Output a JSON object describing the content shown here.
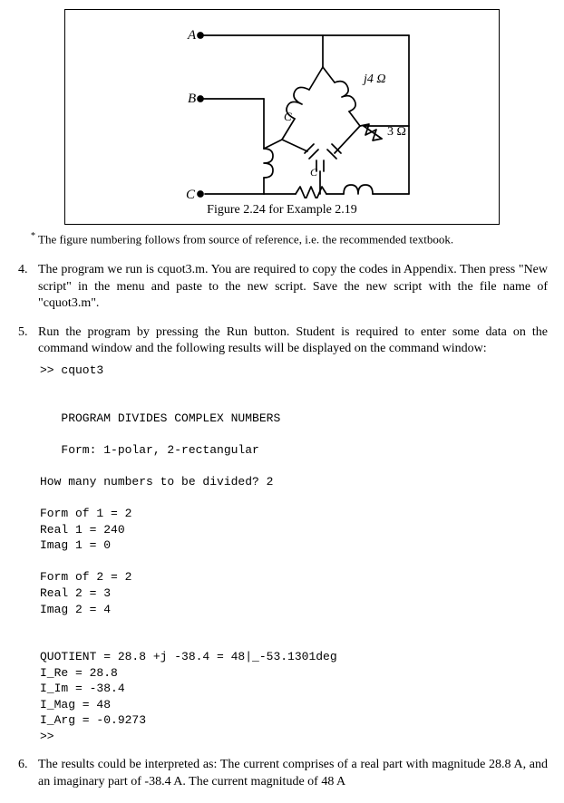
{
  "figure": {
    "labels": {
      "A": "A",
      "B": "B",
      "C_bottom": "C",
      "C_small1": "C",
      "C_small2": "C",
      "j4": "j4 Ω",
      "r3": "3 Ω"
    },
    "caption": "Figure 2.24 for Example 2.19"
  },
  "footnote": {
    "mark": "*",
    "text": "The figure numbering follows from source of reference, i.e. the recommended textbook."
  },
  "steps": {
    "s4": {
      "num": "4.",
      "body": "The program we run is cquot3.m. You are required to copy the codes in Appendix. Then press \"New script\" in the menu and paste to the new script. Save the new script with the file name of \"cquot3.m\"."
    },
    "s5": {
      "num": "5.",
      "body": "Run the program by pressing the Run button. Student is required to enter some data on the command window and the following results will be displayed on the command window:"
    },
    "s6": {
      "num": "6.",
      "body": "The results could be interpreted as: The current comprises of a real part with magnitude 28.8 A, and an imaginary part of -38.4 A. The current magnitude of 48 A"
    }
  },
  "code": {
    "prompt1": ">> cquot3",
    "header": "   PROGRAM DIVIDES COMPLEX NUMBERS",
    "formline": "   Form: 1-polar, 2-rectangular",
    "qcount": "How many numbers to be divided? 2",
    "form1": "Form of 1 = 2",
    "real1": "Real 1 = 240",
    "imag1": "Imag 1 = 0",
    "form2": "Form of 2 = 2",
    "real2": "Real 2 = 3",
    "imag2": "Imag 2 = 4",
    "quot": "QUOTIENT = 28.8 +j -38.4 = 48|_-53.1301deg",
    "ire": "I_Re = 28.8",
    "iim": "I_Im = -38.4",
    "imag": "I_Mag = 48",
    "iarg": "I_Arg = -0.9273",
    "prompt2": ">>"
  }
}
